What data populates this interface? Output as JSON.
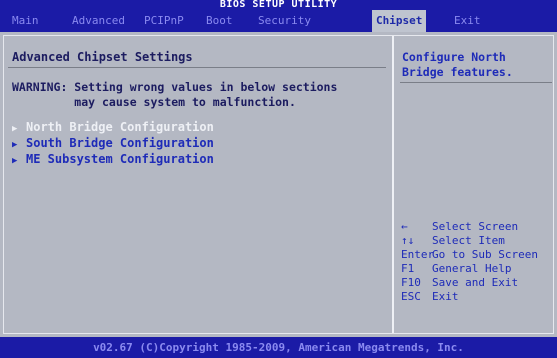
{
  "title": "BIOS SETUP UTILITY",
  "tabs": [
    "Main",
    "Advanced",
    "PCIPnP",
    "Boot",
    "Security",
    "Chipset",
    "Exit"
  ],
  "section_title": "Advanced Chipset Settings",
  "warning_line1": "WARNING: Setting wrong values in below sections",
  "warning_line2": "         may cause system to malfunction.",
  "menu": [
    "North Bridge Configuration",
    "South Bridge Configuration",
    "ME Subsystem Configuration"
  ],
  "help": "Configure North Bridge features.",
  "legend": [
    {
      "key": "←",
      "desc": "Select Screen"
    },
    {
      "key": "↑↓",
      "desc": "Select Item"
    },
    {
      "key": "Enter",
      "desc": "Go to Sub Screen"
    },
    {
      "key": "F1",
      "desc": "General Help"
    },
    {
      "key": "F10",
      "desc": "Save and Exit"
    },
    {
      "key": "ESC",
      "desc": "Exit"
    }
  ],
  "footer": "v02.67 (C)Copyright 1985-2009, American Megatrends, Inc.",
  "colors": {
    "background": "#1a1a9a",
    "panel": "#b4b8c3",
    "accent": "#1e2bb8"
  }
}
